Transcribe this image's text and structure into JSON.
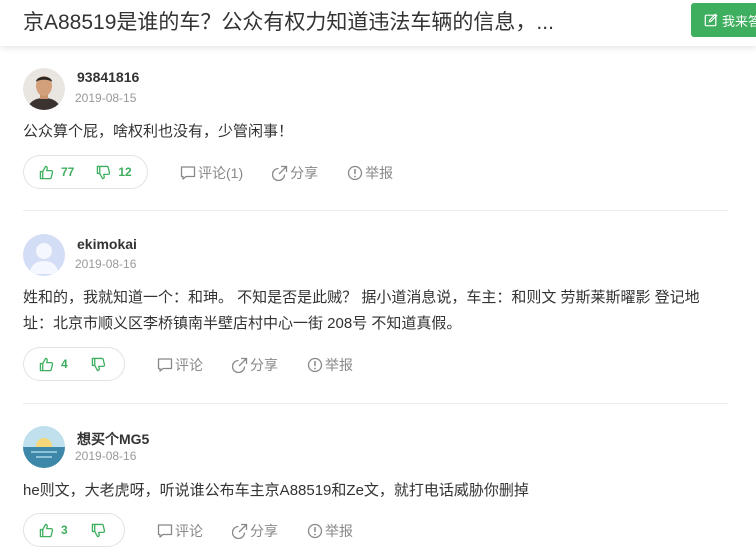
{
  "header": {
    "title": "京A88519是谁的车？公众有权力知道违法车辆的信息，...",
    "answer_button_label": "我来答"
  },
  "colors": {
    "accent_green": "#3eaf5f",
    "text_gray": "#888888"
  },
  "answers": [
    {
      "username": "93841816",
      "date": "2019-08-15",
      "avatar": "photo-avatar",
      "content": "公众算个屁，啥权利也没有，少管闲事！",
      "upvotes": "77",
      "downvotes": "12",
      "comment_label": "评论(1)",
      "share_label": "分享",
      "report_label": "举报"
    },
    {
      "username": "ekimokai",
      "date": "2019-08-16",
      "avatar": "default-user-icon",
      "content": "姓和的，我就知道一个：和珅。 不知是否是此贼？ 据小道消息说，车主：和则文 劳斯莱斯曜影 登记地址：北京市顺义区李桥镇南半壁店村中心一街 208号 不知道真假。",
      "upvotes": "4",
      "downvotes": "",
      "comment_label": "评论",
      "share_label": "分享",
      "report_label": "举报"
    },
    {
      "username": "想买个MG5",
      "date": "2019-08-16",
      "avatar": "sunset-avatar",
      "content": "he则文，大老虎呀，听说谁公布车主京A88519和Ze文，就打电话威胁你删掉",
      "upvotes": "3",
      "downvotes": "",
      "comment_label": "评论",
      "share_label": "分享",
      "report_label": "举报"
    }
  ]
}
